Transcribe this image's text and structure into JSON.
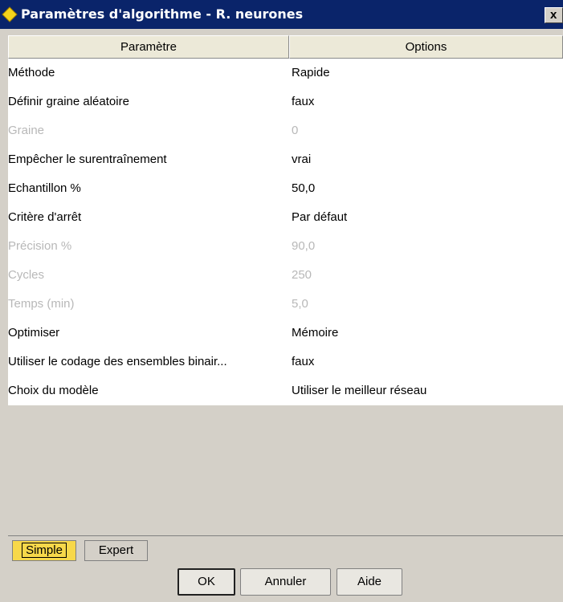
{
  "window": {
    "title": "Paramètres d'algorithme - R. neurones",
    "close_label": "x"
  },
  "table": {
    "columns": [
      "Paramètre",
      "Options"
    ],
    "rows": [
      {
        "param": "Méthode",
        "option": "Rapide",
        "enabled": true
      },
      {
        "param": "Définir graine aléatoire",
        "option": "faux",
        "enabled": true
      },
      {
        "param": "Graine",
        "option": "0",
        "enabled": false
      },
      {
        "param": "Empêcher le surentraînement",
        "option": "vrai",
        "enabled": true
      },
      {
        "param": "Echantillon %",
        "option": "50,0",
        "enabled": true
      },
      {
        "param": "Critère d'arrêt",
        "option": "Par défaut",
        "enabled": true
      },
      {
        "param": "Précision %",
        "option": "90,0",
        "enabled": false
      },
      {
        "param": "Cycles",
        "option": "250",
        "enabled": false
      },
      {
        "param": "Temps (min)",
        "option": "5,0",
        "enabled": false
      },
      {
        "param": "Optimiser",
        "option": "Mémoire",
        "enabled": true
      },
      {
        "param": "Utiliser le codage des ensembles binair...",
        "option": "faux",
        "enabled": true
      },
      {
        "param": "Choix du modèle",
        "option": "Utiliser le meilleur réseau",
        "enabled": true
      }
    ]
  },
  "tabs": {
    "simple": "Simple",
    "expert": "Expert"
  },
  "buttons": {
    "ok": "OK",
    "cancel": "Annuler",
    "help": "Aide"
  }
}
